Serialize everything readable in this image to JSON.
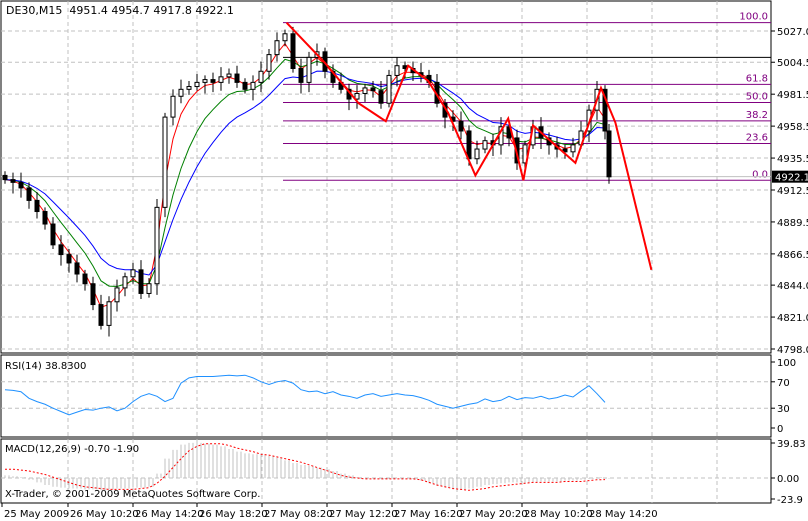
{
  "chart_data": [
    {
      "type": "candlestick",
      "title": "DE30,M15",
      "ohlc_label": "4951.4 4954.7 4917.8 4922.1",
      "current_price": "4922.1",
      "ylim": [
        4798.0,
        5027.0
      ],
      "y_ticks": [
        "5027.0",
        "5004.5",
        "4981.5",
        "4958.5",
        "4935.5",
        "4912.5",
        "4889.5",
        "4866.5",
        "4844.0",
        "4821.0",
        "4798.0"
      ],
      "y_tick_values": [
        5027.0,
        5004.5,
        4981.5,
        4958.5,
        4935.5,
        4912.5,
        4889.5,
        4866.5,
        4844.0,
        4821.0,
        4798.0
      ],
      "close": [
        4920,
        4918,
        4914,
        4905,
        4897,
        4888,
        4873,
        4866,
        4860,
        4852,
        4845,
        4830,
        4815,
        4832,
        4842,
        4850,
        4855,
        4838,
        4845,
        4900,
        4965,
        4980,
        4985,
        4987,
        4990,
        4992,
        4990,
        4994,
        4996,
        4990,
        4985,
        4990,
        4998,
        5010,
        5020,
        5025,
        5000,
        4990,
        5008,
        5012,
        4998,
        4990,
        4985,
        4978,
        4982,
        4986,
        4984,
        4975,
        4995,
        5002,
        5000,
        4997,
        4995,
        4990,
        4975,
        4965,
        4962,
        4955,
        4935,
        4942,
        4948,
        4945,
        4958,
        4950,
        4932,
        4945,
        4958,
        4950,
        4945,
        4942,
        4940,
        4945,
        4955,
        4970,
        4985,
        4955,
        4922
      ],
      "moving_averages": [
        {
          "name": "MA fast",
          "color": "#ff0000",
          "period": 3
        },
        {
          "name": "MA mid",
          "color": "#008000",
          "period": 7
        },
        {
          "name": "MA slow",
          "color": "#0000ff",
          "period": 12
        }
      ],
      "fibonacci": {
        "levels": [
          {
            "label": "100.0",
            "price": 5033
          },
          {
            "label": "61.8",
            "price": 4988.6
          },
          {
            "label": "50.0",
            "price": 4975.5
          },
          {
            "label": "38.2",
            "price": 4962.3
          },
          {
            "label": "23.6",
            "price": 4946
          },
          {
            "label": "0.0",
            "price": 4919.5
          }
        ],
        "color": "#800080"
      },
      "zigzag": {
        "color": "#ff0000",
        "points": [
          [
            35.2,
            5033
          ],
          [
            40,
            5004
          ],
          [
            44.2,
            4975
          ],
          [
            47.6,
            4962
          ],
          [
            50.4,
            5002
          ],
          [
            52.9,
            4991
          ],
          [
            55.4,
            4968
          ],
          [
            58.8,
            4923
          ],
          [
            62.9,
            4964
          ],
          [
            64.8,
            4919.5
          ],
          [
            66,
            4959
          ],
          [
            71.3,
            4932
          ],
          [
            74.5,
            4986
          ],
          [
            76.3,
            4961
          ],
          [
            80.8,
            4855
          ]
        ]
      },
      "extra_hlines": [
        {
          "price": 5008
        }
      ]
    },
    {
      "type": "line",
      "title": "RSI(14) 38.8300",
      "ylim": [
        0,
        100
      ],
      "y_ticks": [
        "100",
        "70",
        "30",
        "0"
      ],
      "y_tick_values": [
        100,
        70,
        30,
        0
      ],
      "levels": [
        70,
        30
      ],
      "color": "#1e90ff",
      "values": [
        58,
        57,
        55,
        45,
        40,
        36,
        30,
        25,
        20,
        24,
        28,
        27,
        30,
        32,
        26,
        30,
        40,
        48,
        52,
        48,
        40,
        45,
        68,
        76,
        78,
        78,
        78,
        79,
        80,
        79,
        80,
        76,
        70,
        66,
        70,
        72,
        68,
        58,
        55,
        56,
        52,
        55,
        50,
        48,
        45,
        50,
        52,
        48,
        50,
        52,
        50,
        49,
        46,
        42,
        36,
        33,
        30,
        33,
        36,
        38,
        44,
        40,
        42,
        48,
        43,
        46,
        45,
        48,
        44,
        46,
        50,
        47,
        56,
        64,
        52,
        38.83
      ]
    },
    {
      "type": "bar+line",
      "title": "MACD(12,26,9) -0.70 -1.90",
      "ylim": [
        -23.9,
        39.83
      ],
      "y_ticks": [
        "39.83",
        "0.00",
        "-23.9"
      ],
      "y_tick_values": [
        39.83,
        0,
        -23.9
      ],
      "histogram_color": "#c0c0c0",
      "signal_color": "#ff0000",
      "histogram": [
        3,
        2,
        1,
        -2,
        -5,
        -8,
        -10,
        -11,
        -12,
        -12,
        -13,
        -13,
        -14,
        -13,
        -12,
        -12,
        -11,
        -11,
        -10,
        5,
        22,
        32,
        38,
        40,
        40,
        39,
        38,
        36,
        33,
        30,
        28,
        27,
        26,
        25,
        23,
        20,
        17,
        15,
        14,
        12,
        10,
        8,
        5,
        3,
        1,
        0,
        0,
        -1,
        -1,
        0,
        0,
        -1,
        -3,
        -6,
        -9,
        -11,
        -13,
        -13,
        -12,
        -10,
        -8,
        -7,
        -6,
        -5,
        -5,
        -6,
        -5,
        -4,
        -4,
        -4,
        -3,
        -3,
        -2,
        -1,
        1,
        -0.7
      ],
      "signal": [
        10,
        10,
        9,
        8,
        6,
        4,
        1,
        -2,
        -5,
        -8,
        -10,
        -11,
        -12,
        -13,
        -13,
        -13,
        -13,
        -12,
        -11,
        -6,
        2,
        12,
        22,
        31,
        36,
        39,
        39,
        39,
        37,
        34,
        32,
        30,
        27,
        26,
        24,
        22,
        20,
        18,
        15,
        12,
        9,
        6,
        3,
        1,
        0,
        -1,
        -1,
        -1,
        -1,
        -1,
        -1,
        -1,
        -2,
        -5,
        -8,
        -10,
        -12,
        -13,
        -14,
        -13,
        -12,
        -10,
        -9,
        -8,
        -7,
        -6,
        -5,
        -5,
        -5,
        -5,
        -4,
        -4,
        -4,
        -3,
        -2,
        -1.9
      ]
    }
  ],
  "x_axis": {
    "labels": [
      "25 May 2009",
      "26 May 10:20",
      "26 May 14:20",
      "26 May 18:20",
      "27 May 08:20",
      "27 May 12:20",
      "27 May 16:20",
      "27 May 20:20",
      "28 May 10:20",
      "28 May 14:20"
    ]
  },
  "footer": {
    "copyright": "X-Trader, © 2001-2009 MetaQuotes Software Corp."
  }
}
